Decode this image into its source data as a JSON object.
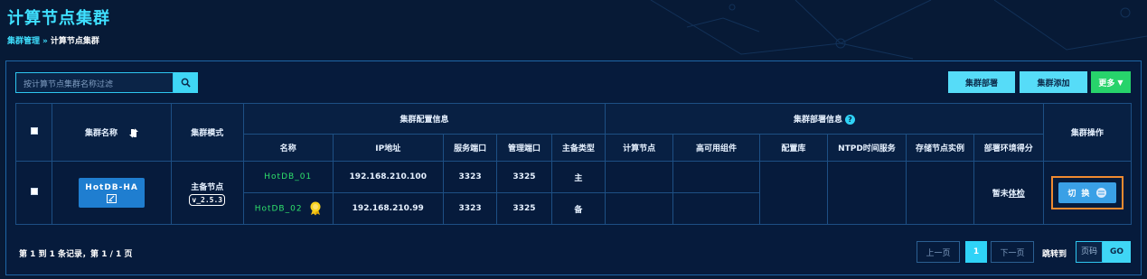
{
  "page": {
    "title": "计算节点集群",
    "breadcrumb": {
      "parent": "集群管理",
      "separator": "»",
      "current": "计算节点集群"
    }
  },
  "toolbar": {
    "search_placeholder": "按计算节点集群名称过滤",
    "search_icon": "search-icon",
    "deploy_label": "集群部署",
    "add_label": "集群添加",
    "more_label": "更多"
  },
  "table": {
    "headers": {
      "name": "集群名称",
      "mode": "集群模式",
      "config_group": "集群配置信息",
      "deploy_group": "集群部署信息",
      "ops": "集群操作",
      "config_cols": [
        "名称",
        "IP地址",
        "服务端口",
        "管理端口",
        "主备类型"
      ],
      "deploy_cols": [
        "计算节点",
        "高可用组件",
        "配置库",
        "NTPD时间服务",
        "存储节点实例",
        "部署环境得分"
      ]
    },
    "rows": [
      {
        "cluster_name": "HotDB-HA",
        "mode": "主备节点",
        "version": "v_2.5.3",
        "nodes": [
          {
            "name": "HotDB_01",
            "ip": "192.168.210.100",
            "service_port": "3323",
            "manage_port": "3325",
            "role": "主"
          },
          {
            "name": "HotDB_02",
            "ip": "192.168.210.99",
            "service_port": "3323",
            "manage_port": "3325",
            "role": "备"
          }
        ],
        "score_prefix": "暂未",
        "score_link": "体检",
        "switch_label": "切换"
      }
    ]
  },
  "pagination": {
    "info": "第 1 到 1 条记录，第 1 / 1 页",
    "prev": "上一页",
    "current": "1",
    "next": "下一页",
    "jump_label": "跳转到",
    "jump_placeholder": "页码",
    "go": "GO"
  },
  "colors": {
    "background": "#071a36",
    "accent": "#3fe0ff",
    "primary_button": "#1f7ed0",
    "more_button": "#27d36b",
    "node_name": "#2fe06b",
    "highlight_border": "#f08a30"
  }
}
